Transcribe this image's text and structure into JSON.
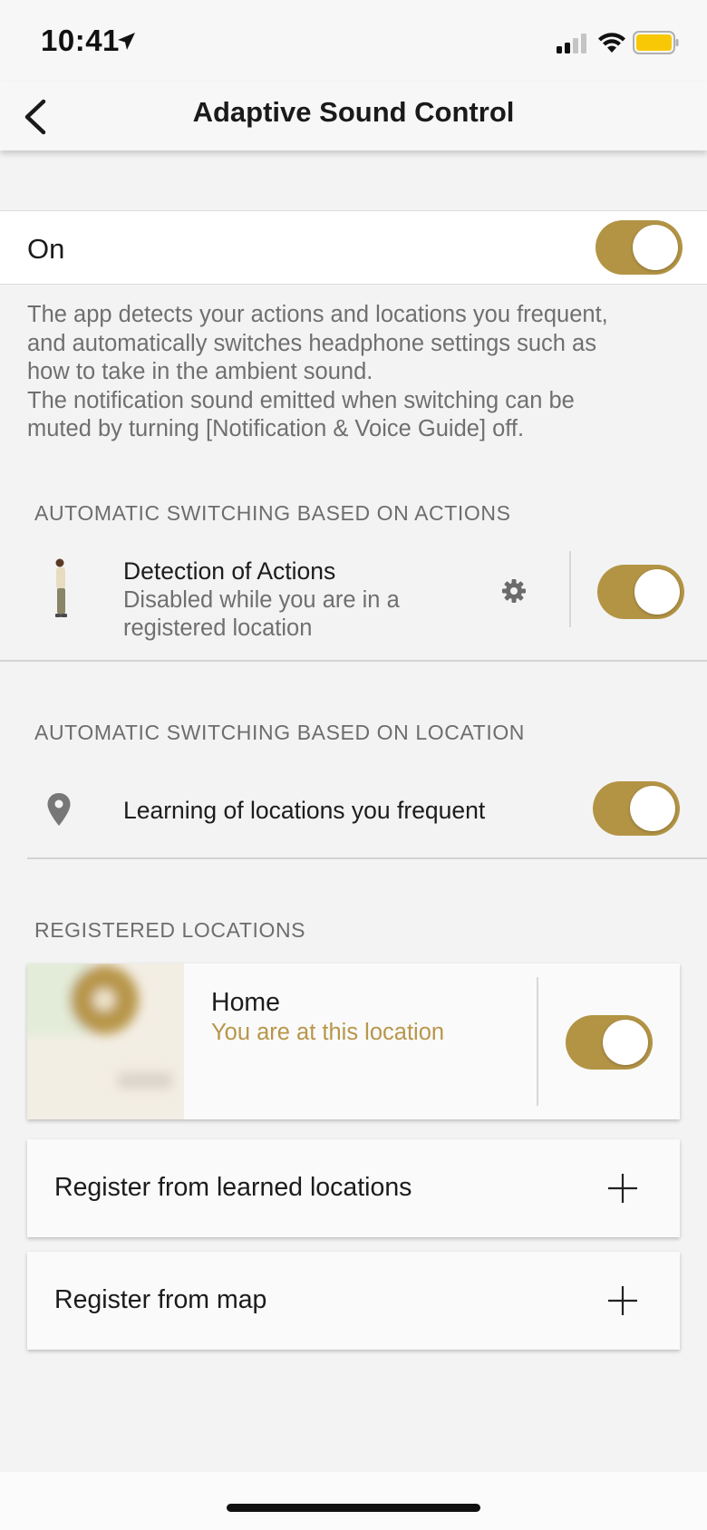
{
  "status_bar": {
    "time": "10:41",
    "battery_color": "#f8c806"
  },
  "nav": {
    "title": "Adaptive Sound Control",
    "back_icon": "chevron-left-icon"
  },
  "master_switch": {
    "label": "On",
    "enabled": true
  },
  "description": [
    "The app detects your actions and locations you frequent,",
    "and automatically switches headphone settings such as",
    "how to take in the ambient sound.",
    "The notification sound emitted when switching can be",
    "muted by turning [Notification & Voice Guide] off."
  ],
  "actions_section": {
    "header": "AUTOMATIC SWITCHING BASED ON ACTIONS",
    "item": {
      "title": "Detection of Actions",
      "subtitle_line1": "Disabled while you are in a",
      "subtitle_line2": "registered location",
      "icon": "standing-person-icon",
      "settings_icon": "gear-icon",
      "enabled": true
    }
  },
  "location_section": {
    "header": "AUTOMATIC SWITCHING BASED ON LOCATION",
    "item": {
      "title": "Learning of locations you frequent",
      "icon": "location-pin-icon",
      "enabled": true
    }
  },
  "registered_section": {
    "header": "REGISTERED LOCATIONS",
    "locations": [
      {
        "name": "Home",
        "status": "You are at this location",
        "enabled": true
      }
    ],
    "actions": [
      {
        "label": "Register from learned locations",
        "icon": "plus-icon"
      },
      {
        "label": "Register from map",
        "icon": "plus-icon"
      }
    ]
  },
  "colors": {
    "accent": "#b39445",
    "status_text": "#b8964a",
    "background": "#f3f3f3"
  }
}
